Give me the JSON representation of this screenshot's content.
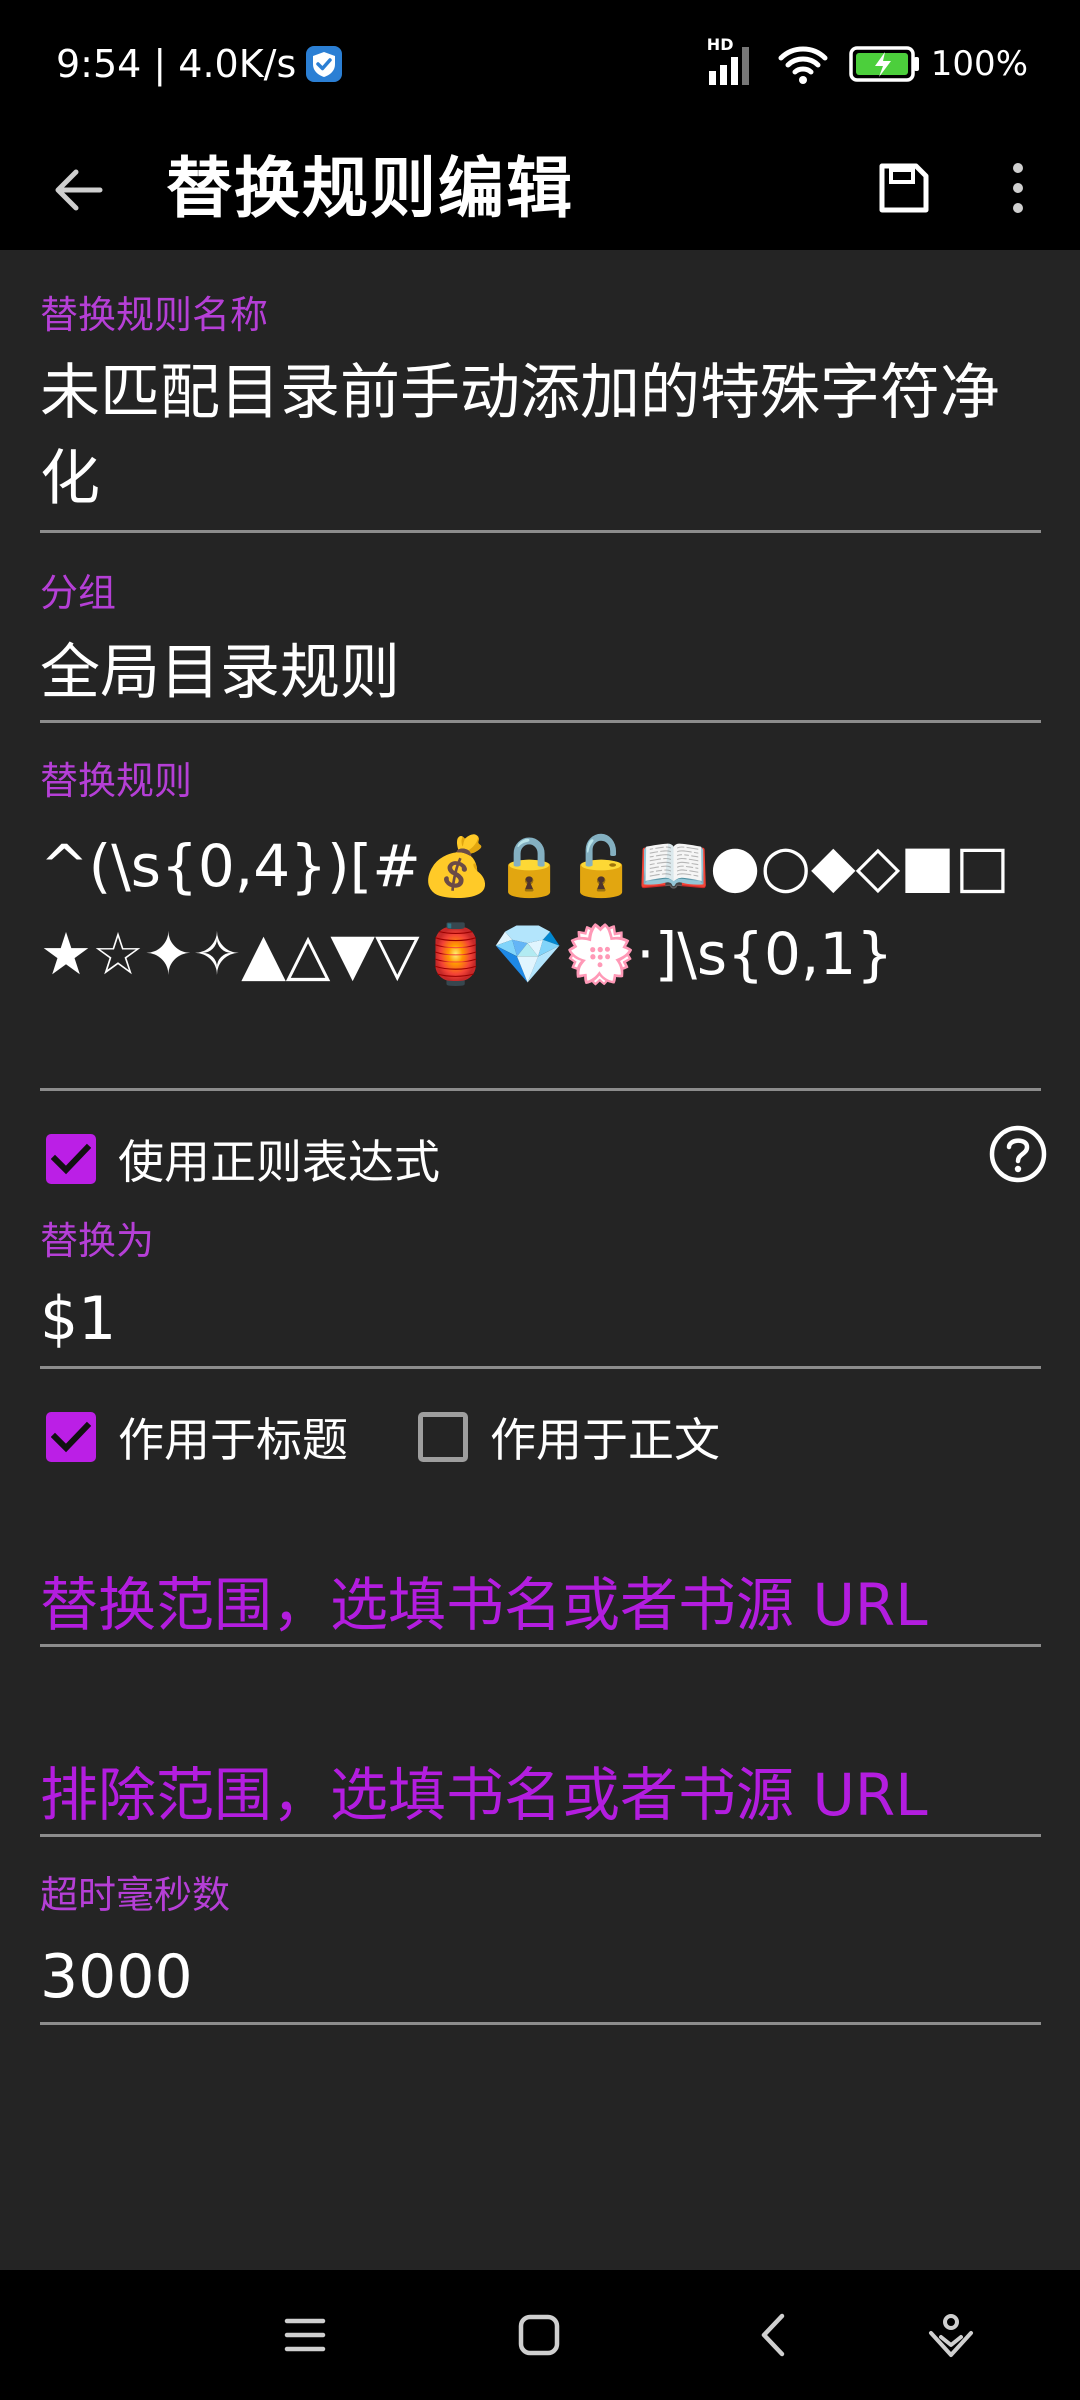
{
  "status_bar": {
    "time_and_speed": "9:54 | 4.0K/s",
    "network_badge": "HD",
    "battery_text": "100%"
  },
  "toolbar": {
    "title": "替换规则编辑"
  },
  "form": {
    "name_label": "替换规则名称",
    "name_value": "未匹配目录前手动添加的特殊字符净化",
    "group_label": "分组",
    "group_value": "全局目录规则",
    "pattern_label": "替换规则",
    "pattern_value": "^(\\s{0,4})[#💰🔒🔓📖●○◆◇■□★☆✦✧▲△▼▽🏮💎💮·]\\s{0,1}",
    "use_regex_label": "使用正则表达式",
    "use_regex_checked": true,
    "replacement_label": "替换为",
    "replacement_value": "$1",
    "apply_to_title_label": "作用于标题",
    "apply_to_title_checked": true,
    "apply_to_content_label": "作用于正文",
    "apply_to_content_checked": false,
    "scope_placeholder": "替换范围，选填书名或者书源 URL",
    "exclude_placeholder": "排除范围，选填书名或者书源 URL",
    "timeout_label": "超时毫秒数",
    "timeout_value": "3000"
  },
  "colors": {
    "accent": "#b31ddf",
    "label": "#b53fd6",
    "background": "#242424",
    "bar": "#000000",
    "divider": "#8c8c8c"
  },
  "icons": {
    "back": "arrow-left-icon",
    "save": "save-icon",
    "more": "more-vertical-icon",
    "help": "help-circle-icon",
    "nav_menu": "menu-icon",
    "nav_home": "home-square-icon",
    "nav_back": "chevron-left-icon",
    "nav_assist": "assistant-icon"
  }
}
